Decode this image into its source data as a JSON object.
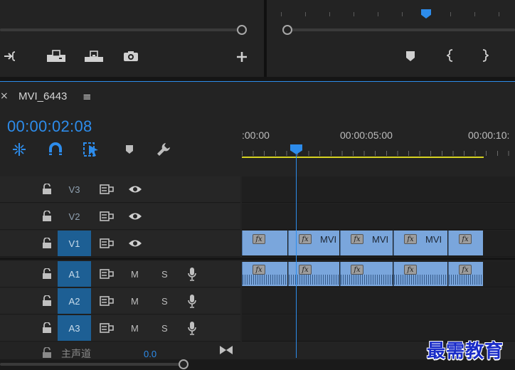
{
  "sequence": {
    "name": "MVI_6443",
    "timecode": "00:00:02:08",
    "ruler_labels": [
      ":00:00",
      "00:00:05:00",
      "00:00:10:"
    ]
  },
  "tracks": {
    "video": [
      {
        "label": "V3",
        "targeted": false
      },
      {
        "label": "V2",
        "targeted": false
      },
      {
        "label": "V1",
        "targeted": true
      }
    ],
    "audio": [
      {
        "label": "A1",
        "targeted": true,
        "m": "M",
        "s": "S"
      },
      {
        "label": "A2",
        "targeted": true,
        "m": "M",
        "s": "S"
      },
      {
        "label": "A3",
        "targeted": true,
        "m": "M",
        "s": "S"
      }
    ],
    "master": {
      "label": "主声道",
      "value": "0.0"
    }
  },
  "clips": [
    {
      "name": "",
      "fx": "fx"
    },
    {
      "name": "MVI",
      "fx": "fx"
    },
    {
      "name": "MVI",
      "fx": "fx"
    },
    {
      "name": "MVI",
      "fx": "fx"
    },
    {
      "name": "",
      "fx": "fx"
    }
  ],
  "icons": {
    "source_controls": [
      "insert-icon",
      "overwrite-lift-icon",
      "export-frame-icon",
      "camera-icon",
      "plus-icon"
    ],
    "program_controls": [
      "marker-icon",
      "mark-in-icon",
      "mark-out-icon"
    ],
    "tools": [
      "ripple-snap-icon",
      "magnet-icon",
      "linked-selection-icon",
      "add-marker-icon",
      "wrench-icon"
    ]
  },
  "colors": {
    "accent": "#2d8ceb",
    "clip": "#7aa6dc",
    "work_area": "#d6d220",
    "target": "#1d5f94"
  },
  "tab": {
    "close": "×",
    "menu": "≡"
  },
  "watermark": "最需教育"
}
